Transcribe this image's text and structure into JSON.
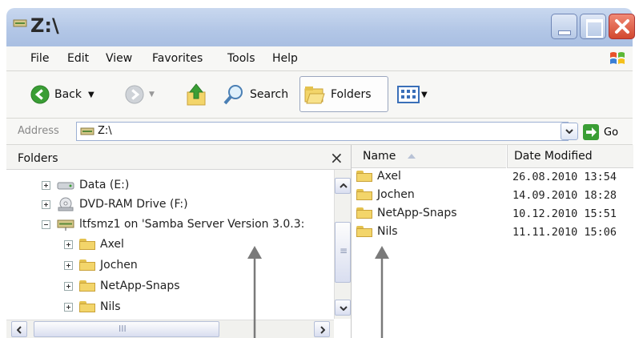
{
  "window": {
    "title": "Z:\\"
  },
  "menu": [
    "File",
    "Edit",
    "View",
    "Favorites",
    "Tools",
    "Help"
  ],
  "toolbar": {
    "back_label": "Back",
    "search_label": "Search",
    "folders_label": "Folders",
    "view_icon": "views-icon"
  },
  "address": {
    "label": "Address",
    "value": "Z:\\",
    "go_label": "Go"
  },
  "folders_pane": {
    "title": "Folders",
    "close_label": "×",
    "items": [
      {
        "label": "Data (E:)",
        "icon": "drive-icon",
        "expander": "+"
      },
      {
        "label": "DVD-RAM Drive (F:)",
        "icon": "dvd-icon",
        "expander": "+"
      },
      {
        "label": "ltfsmz1 on 'Samba Server Version 3.0.3:",
        "icon": "network-drive-icon",
        "expander": "-"
      },
      {
        "label": "Axel",
        "icon": "folder-icon",
        "expander": "+"
      },
      {
        "label": "Jochen",
        "icon": "folder-icon",
        "expander": "+"
      },
      {
        "label": "NetApp-Snaps",
        "icon": "folder-icon",
        "expander": "+"
      },
      {
        "label": "Nils",
        "icon": "folder-icon",
        "expander": "+"
      }
    ],
    "hscroll_label": "III",
    "vscroll_label": "≡"
  },
  "files": {
    "columns": [
      "Name",
      "Date Modified"
    ],
    "rows": [
      {
        "name": "Axel",
        "date": "26.08.2010 13:54"
      },
      {
        "name": "Jochen",
        "date": "14.09.2010 18:28"
      },
      {
        "name": "NetApp-Snaps",
        "date": "10.12.2010 15:51"
      },
      {
        "name": "Nils",
        "date": "11.11.2010 15:06"
      }
    ]
  },
  "colors": {
    "titlebar": "#b2c6e6",
    "close": "#d2482e",
    "folder": "#f3d56a",
    "arrow": "#7a7a7a"
  }
}
